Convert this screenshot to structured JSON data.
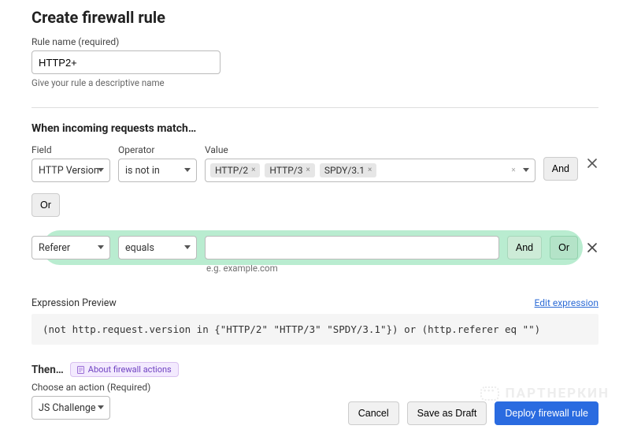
{
  "header": {
    "title": "Create firewall rule"
  },
  "rule_name": {
    "label": "Rule name (required)",
    "value": "HTTP2+",
    "hint": "Give your rule a descriptive name"
  },
  "match": {
    "heading": "When incoming requests match…",
    "columns": {
      "field": "Field",
      "operator": "Operator",
      "value": "Value"
    },
    "row1": {
      "field": "HTTP Version",
      "operator": "is not in",
      "tags": [
        "HTTP/2",
        "HTTP/3",
        "SPDY/3.1"
      ],
      "and_label": "And"
    },
    "or_label": "Or",
    "row2": {
      "field": "Referer",
      "operator": "equals",
      "value": "",
      "placeholder": "e.g. example.com",
      "and_label": "And",
      "or_label": "Or"
    }
  },
  "expression": {
    "label": "Expression Preview",
    "edit_label": "Edit expression",
    "code": "(not http.request.version in {\"HTTP/2\" \"HTTP/3\" \"SPDY/3.1\"}) or (http.referer eq \"\")"
  },
  "then": {
    "heading": "Then…",
    "link_label": "About firewall actions",
    "choose_label": "Choose an action (Required)",
    "action": "JS Challenge"
  },
  "footer": {
    "cancel": "Cancel",
    "save_draft": "Save as Draft",
    "deploy": "Deploy firewall rule"
  },
  "watermark": "ПАРТНЕРКИН"
}
